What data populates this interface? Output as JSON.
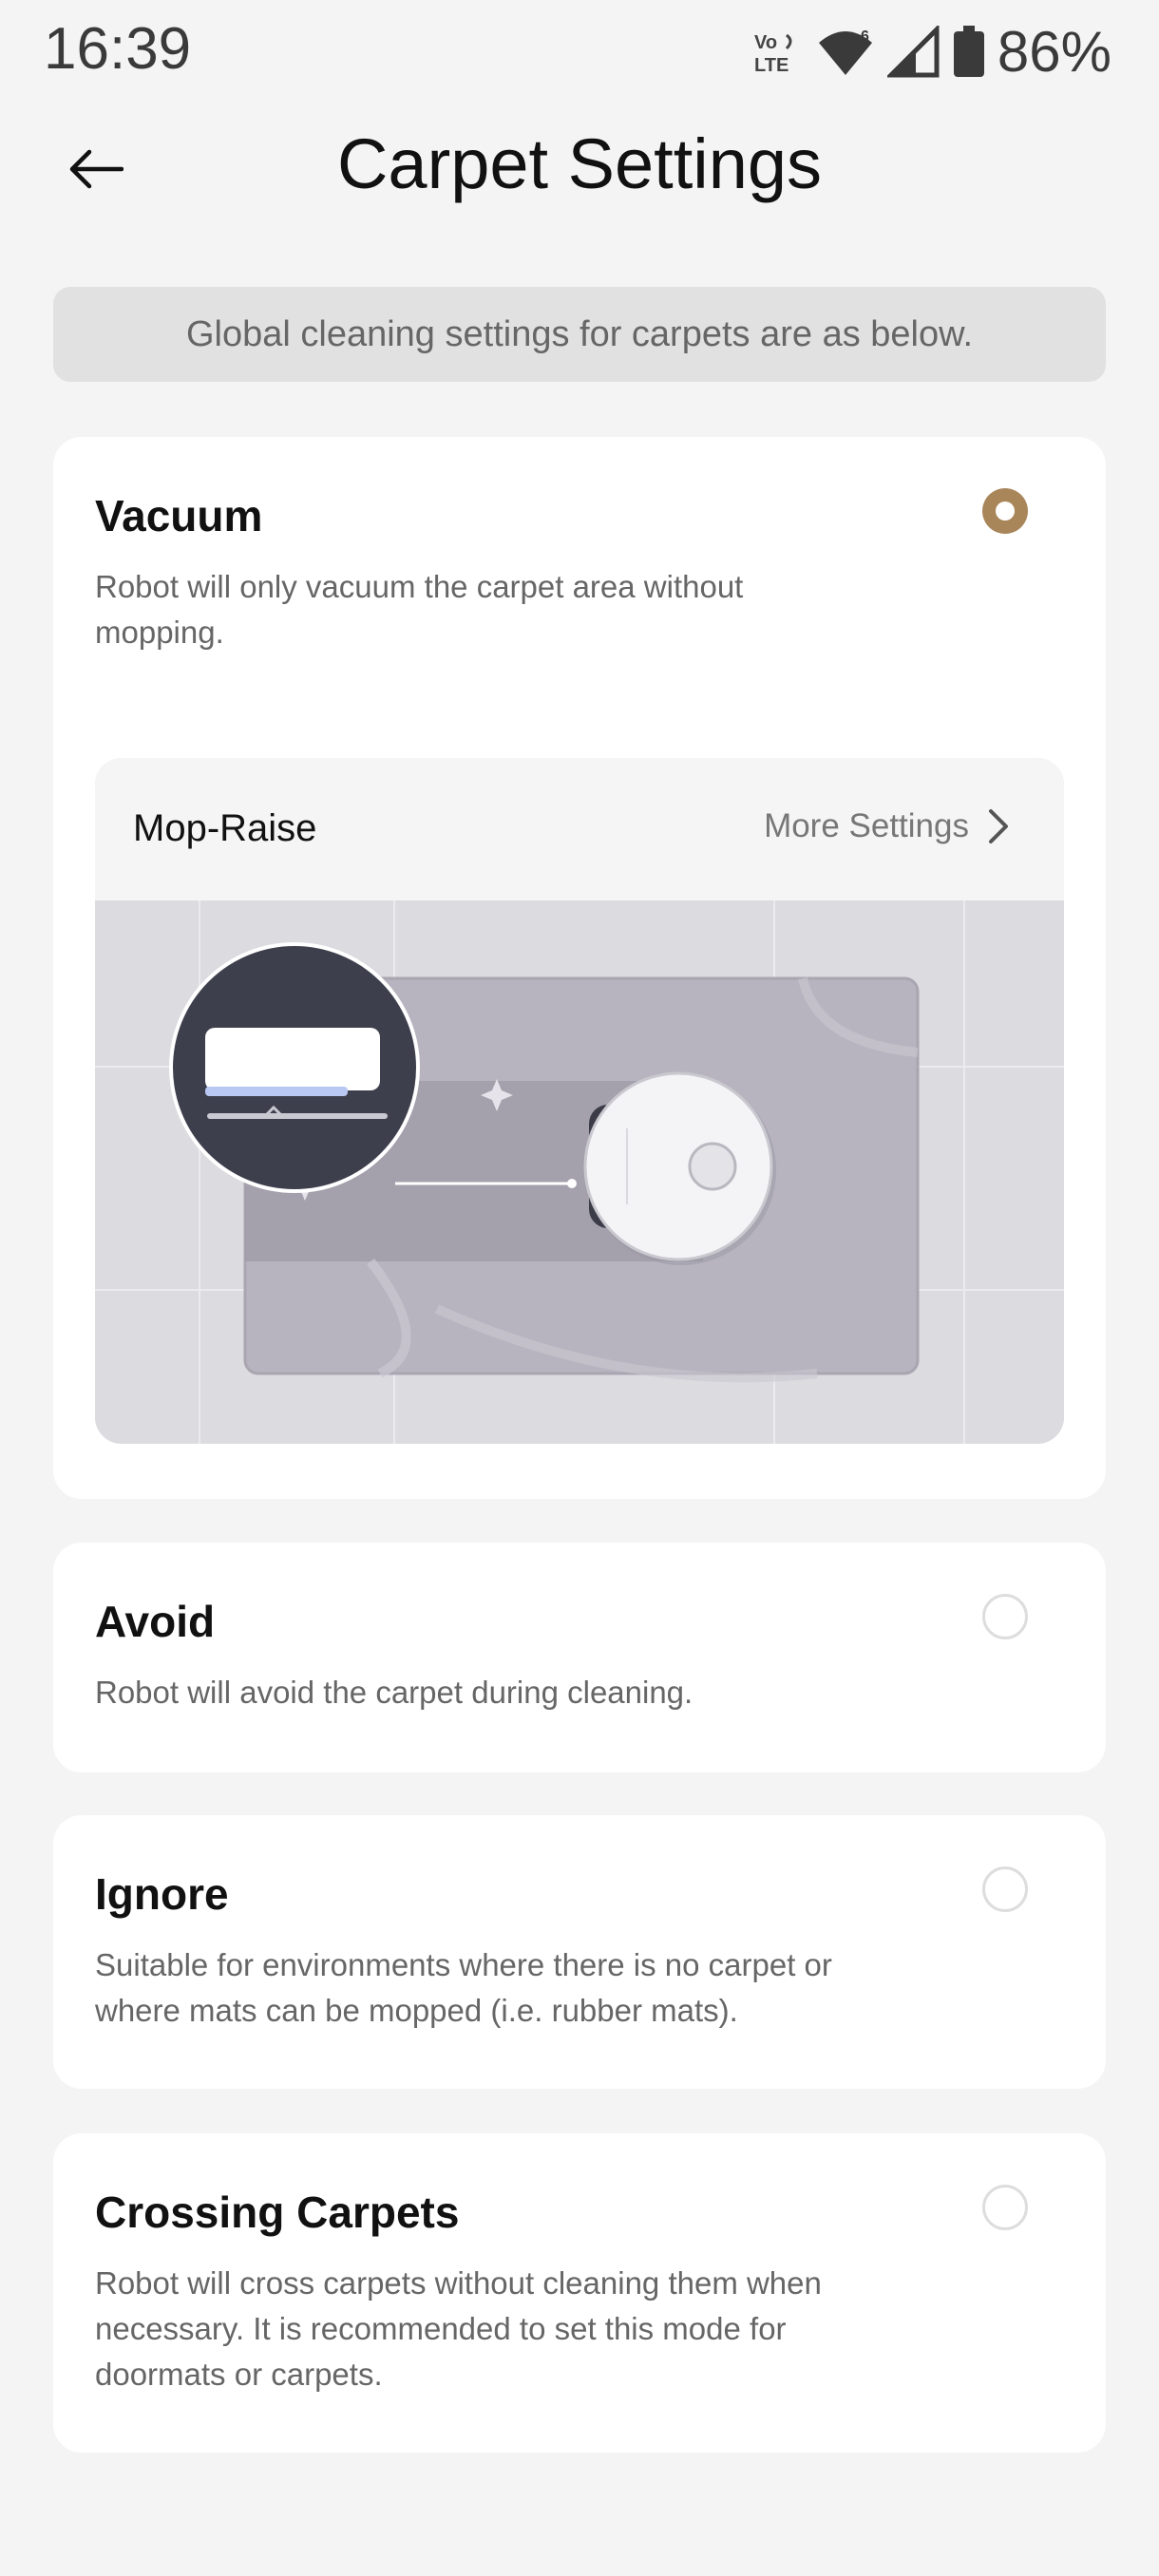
{
  "status_bar": {
    "time": "16:39",
    "network_badge": "Vo LTE",
    "wifi_badge": "6",
    "battery": "86%"
  },
  "header": {
    "title": "Carpet Settings",
    "back_icon": "arrow-left-icon"
  },
  "info": {
    "text": "Global cleaning settings for carpets are as below."
  },
  "options": [
    {
      "title": "Vacuum",
      "description": "Robot will only vacuum the carpet area without mopping.",
      "selected": true,
      "mop_raise": {
        "title": "Mop-Raise",
        "more_label": "More Settings"
      }
    },
    {
      "title": "Avoid",
      "description": "Robot will avoid the carpet during cleaning.",
      "selected": false
    },
    {
      "title": "Ignore",
      "description": "Suitable for environments where there is no carpet or where mats can be mopped (i.e. rubber mats).",
      "selected": false
    },
    {
      "title": "Crossing Carpets",
      "description": "Robot will cross carpets without cleaning them when necessary. It is recommended to set this mode for doormats or carpets.",
      "selected": false
    }
  ],
  "colors": {
    "accent": "#a8865a",
    "background": "#f4f4f4",
    "card": "#ffffff"
  }
}
